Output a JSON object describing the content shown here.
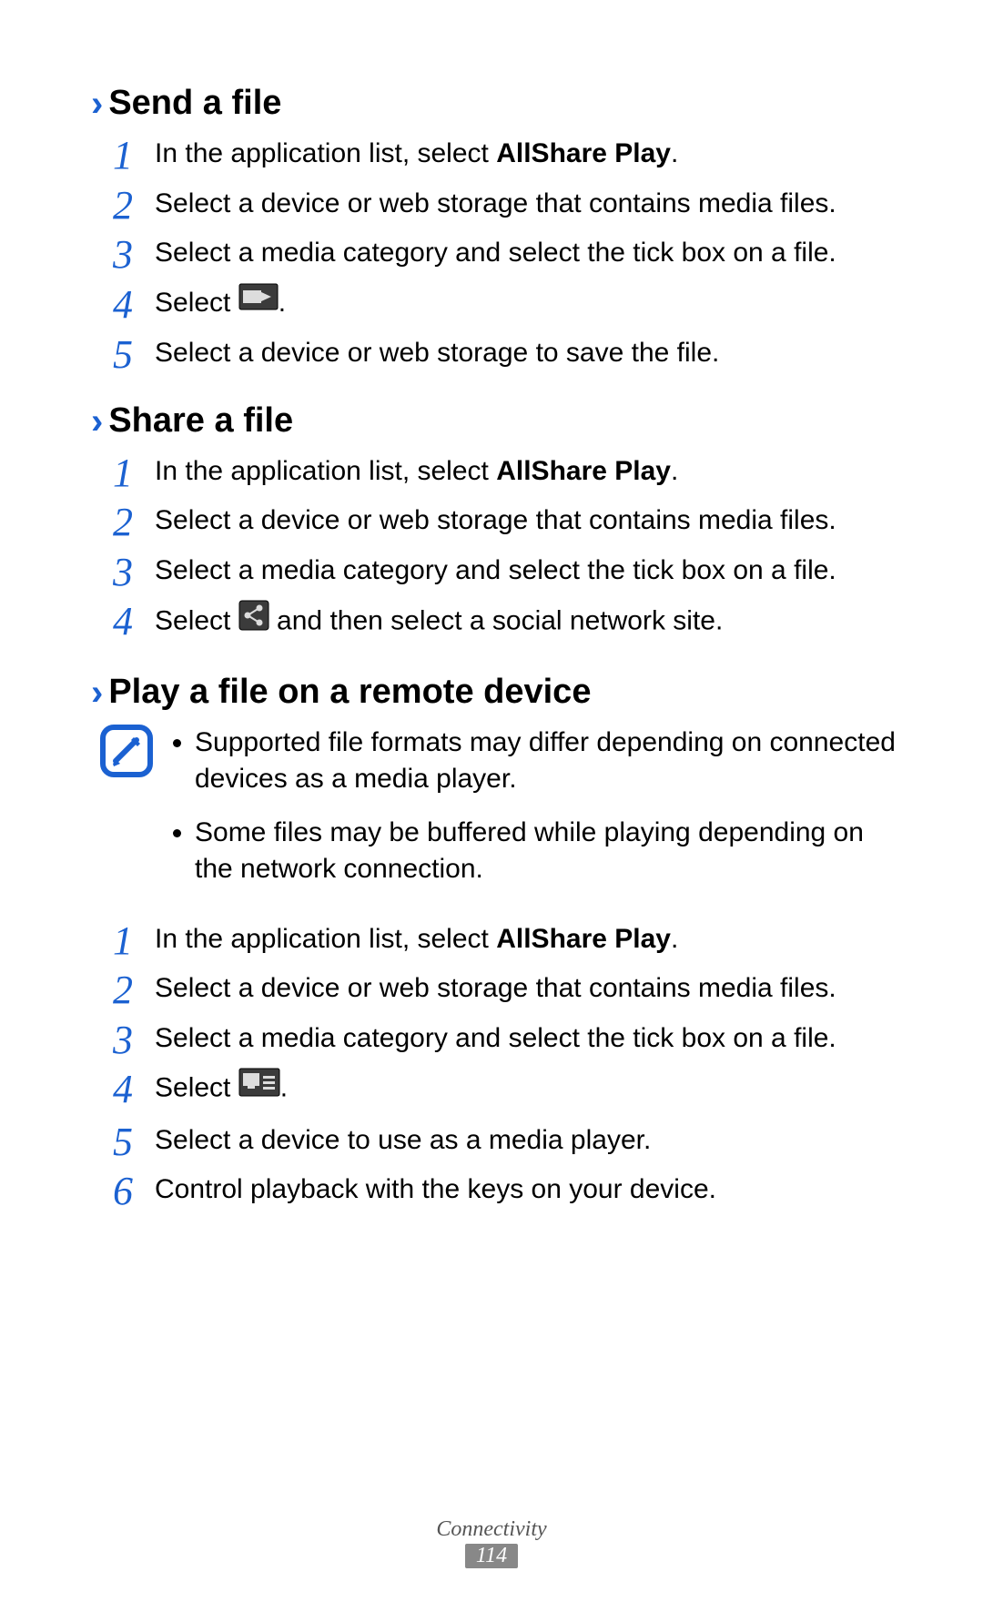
{
  "sections": [
    {
      "title": "Send a file",
      "steps": [
        {
          "pre": "In the application list, select ",
          "bold": "AllShare Play",
          "post": "."
        },
        {
          "text": "Select a device or web storage that contains media files."
        },
        {
          "text": "Select a media category and select the tick box on a file."
        },
        {
          "pre": "Select ",
          "icon": "send-to-icon",
          "post": "."
        },
        {
          "text": "Select a device or web storage to save the file."
        }
      ]
    },
    {
      "title": "Share a file",
      "steps": [
        {
          "pre": "In the application list, select ",
          "bold": "AllShare Play",
          "post": "."
        },
        {
          "text": "Select a device or web storage that contains media files."
        },
        {
          "text": "Select a media category and select the tick box on a file."
        },
        {
          "pre": "Select ",
          "icon": "share-icon",
          "post": " and then select a social network site."
        }
      ]
    },
    {
      "title": "Play a file on a remote device",
      "notes": [
        "Supported file formats may differ depending on connected devices as a media player.",
        "Some files may be buffered while playing depending on the network connection."
      ],
      "steps": [
        {
          "pre": "In the application list, select ",
          "bold": "AllShare Play",
          "post": "."
        },
        {
          "text": "Select a device or web storage that contains media files."
        },
        {
          "text": "Select a media category and select the tick box on a file."
        },
        {
          "pre": "Select ",
          "icon": "remote-play-icon",
          "post": "."
        },
        {
          "text": "Select a device to use as a media player."
        },
        {
          "text": "Control playback with the keys on your device."
        }
      ]
    }
  ],
  "footer": {
    "chapter": "Connectivity",
    "page": "114"
  }
}
